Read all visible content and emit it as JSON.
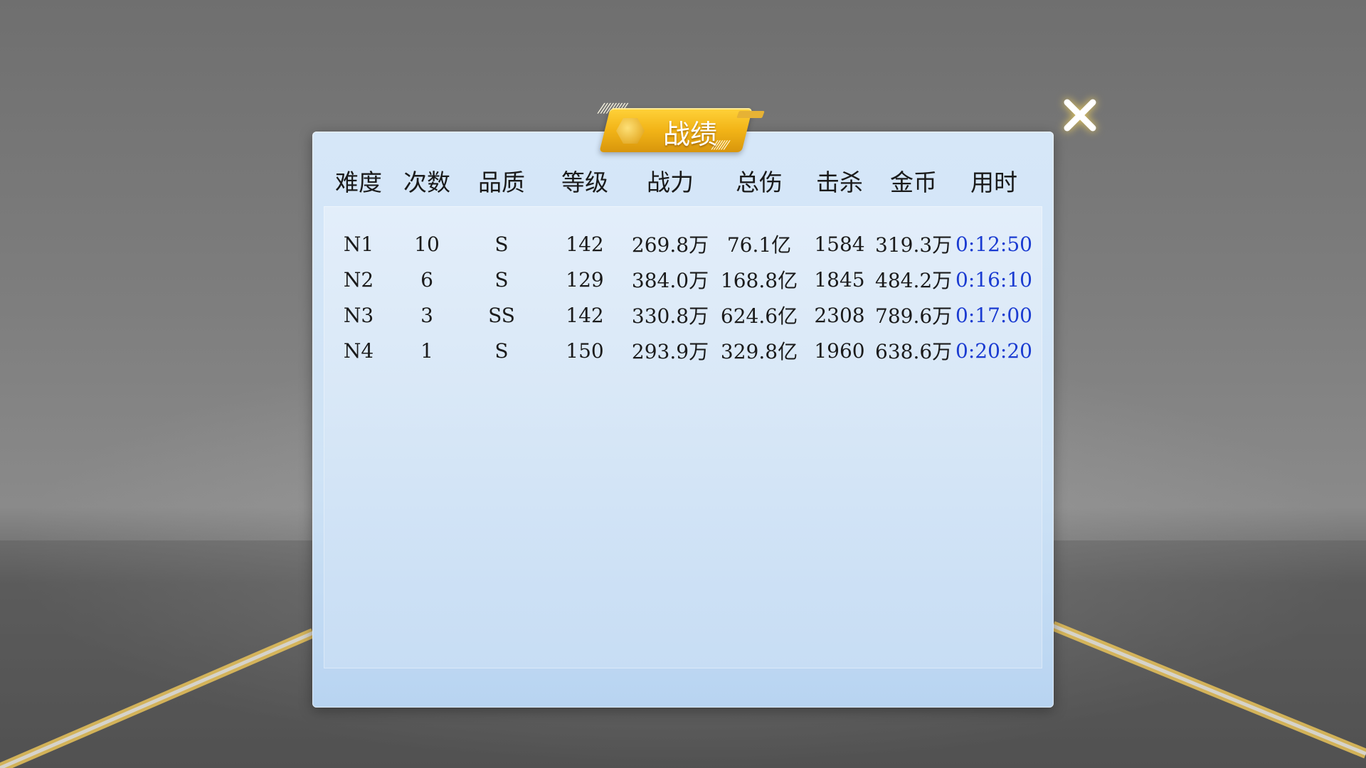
{
  "title": "战绩",
  "close_icon": "close-icon",
  "colors": {
    "badge": "#f2b417",
    "panel": "#cfe3f6",
    "time_text": "#1a3bd1"
  },
  "table": {
    "headers": [
      "难度",
      "次数",
      "品质",
      "等级",
      "战力",
      "总伤",
      "击杀",
      "金币",
      "用时"
    ],
    "rows": [
      [
        "N1",
        "10",
        "S",
        "142",
        "269.8万",
        "76.1亿",
        "1584",
        "319.3万",
        "0:12:50"
      ],
      [
        "N2",
        "6",
        "S",
        "129",
        "384.0万",
        "168.8亿",
        "1845",
        "484.2万",
        "0:16:10"
      ],
      [
        "N3",
        "3",
        "SS",
        "142",
        "330.8万",
        "624.6亿",
        "2308",
        "789.6万",
        "0:17:00"
      ],
      [
        "N4",
        "1",
        "S",
        "150",
        "293.9万",
        "329.8亿",
        "1960",
        "638.6万",
        "0:20:20"
      ]
    ]
  }
}
